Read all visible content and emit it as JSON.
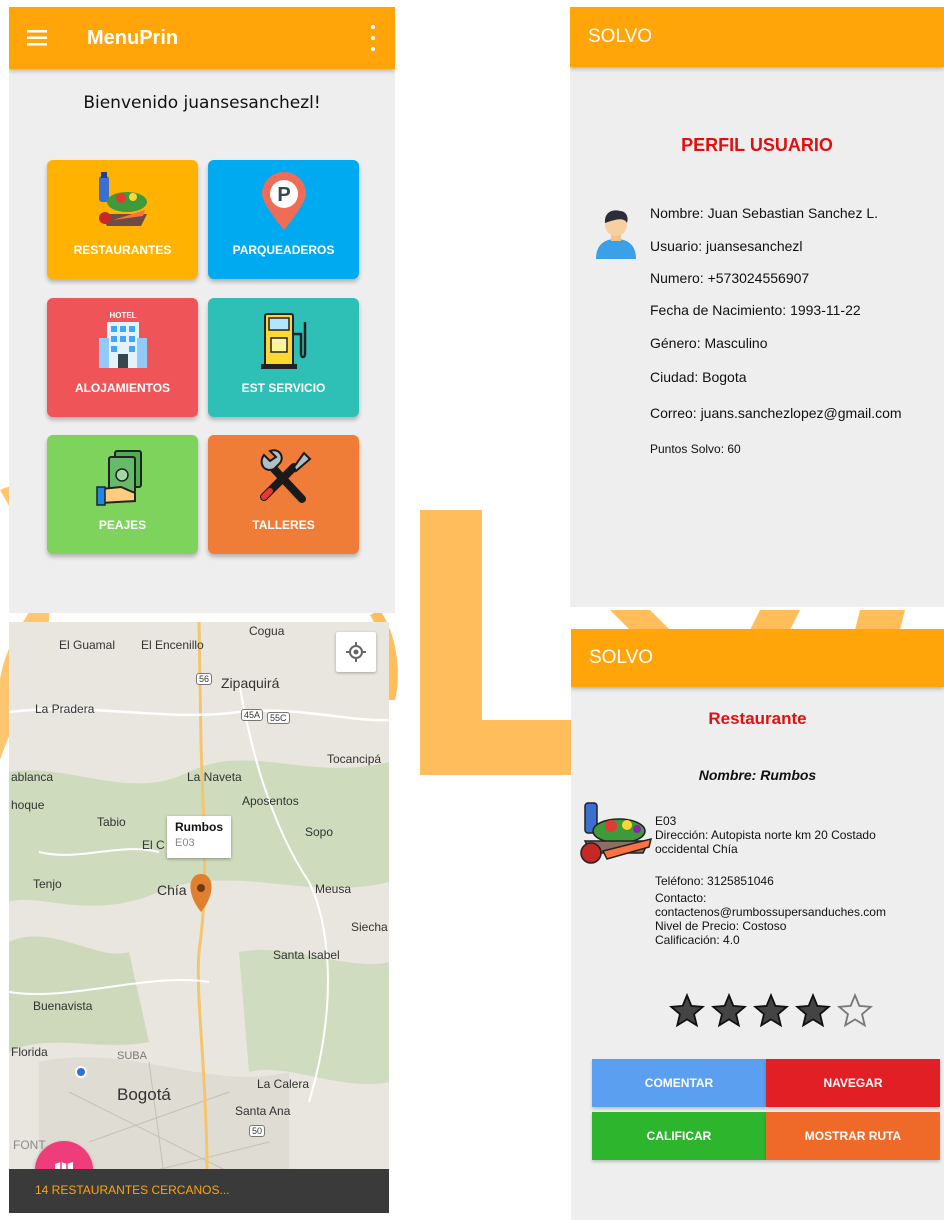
{
  "menu_screen": {
    "app_title": "MenuPrin",
    "welcome": "Bienvenido juansesanchezl!",
    "tiles": [
      {
        "label": "RESTAURANTES",
        "color": "#ffb300",
        "icon": "food-basket-icon"
      },
      {
        "label": "PARQUEADEROS",
        "color": "#00aaf1",
        "icon": "parking-pin-icon"
      },
      {
        "label": "ALOJAMIENTOS",
        "color": "#ef5558",
        "icon": "hotel-icon"
      },
      {
        "label": "EST SERVICIO",
        "color": "#2ebfb6",
        "icon": "fuel-pump-icon"
      },
      {
        "label": "PEAJES",
        "color": "#7dd35b",
        "icon": "money-hand-icon"
      },
      {
        "label": "TALLERES",
        "color": "#ef7d37",
        "icon": "tools-icon"
      }
    ]
  },
  "profile_screen": {
    "app_title": "SOLVO",
    "heading": "PERFIL USUARIO",
    "fields": [
      "Nombre: Juan Sebastian Sanchez L.",
      "Usuario: juansesanchezl",
      "Numero: +573024556907",
      "Fecha de Nacimiento: 1993-11-22",
      "Género: Masculino",
      "Ciudad: Bogota",
      "Correo: juans.sanchezlopez@gmail.com",
      "Puntos Solvo: 60"
    ]
  },
  "map_screen": {
    "places": [
      "Cogua",
      "El Guamal",
      "El Encenillo",
      "Zipaquirá",
      "La Pradera",
      "Tocancipá",
      "ablanca",
      "La Naveta",
      "Aposentos",
      "hoque",
      "Tabio",
      "Sopo",
      "El C",
      "Tenjo",
      "Chía",
      "Meusa",
      "Siecha",
      "Santa Isabel",
      "Buenavista",
      "Florida",
      "SUBA",
      "Bogotá",
      "La Calera",
      "Santa Ana",
      "FONT"
    ],
    "road_labels": [
      "56",
      "45A",
      "55C",
      "50"
    ],
    "popup_title": "Rumbos",
    "popup_code": "E03",
    "bottom_text": "14 RESTAURANTES CERCANOS..."
  },
  "restaurant_screen": {
    "app_title": "SOLVO",
    "heading": "Restaurante",
    "name_line": "Nombre: Rumbos",
    "code": "E03",
    "address": [
      "Dirección: Autopista norte km 20 Costado",
      "occidental Chía"
    ],
    "phone": "Teléfono: 3125851046",
    "contact_label": "Contacto:",
    "contact": "contactenos@rumbossupersanduches.com",
    "price": "Nivel de Precio: Costoso",
    "rating_text": "Calificación: 4.0",
    "rating": 4,
    "rating_max": 5,
    "buttons": [
      {
        "label": "COMENTAR",
        "color": "#5a9ff0"
      },
      {
        "label": "NAVEGAR",
        "color": "#e21f25"
      },
      {
        "label": "CALIFICAR",
        "color": "#2db52d"
      },
      {
        "label": "MOSTRAR RUTA",
        "color": "#ef6a28"
      }
    ]
  },
  "colors": {
    "accent": "#ffa409",
    "title_red": "#e01010"
  }
}
